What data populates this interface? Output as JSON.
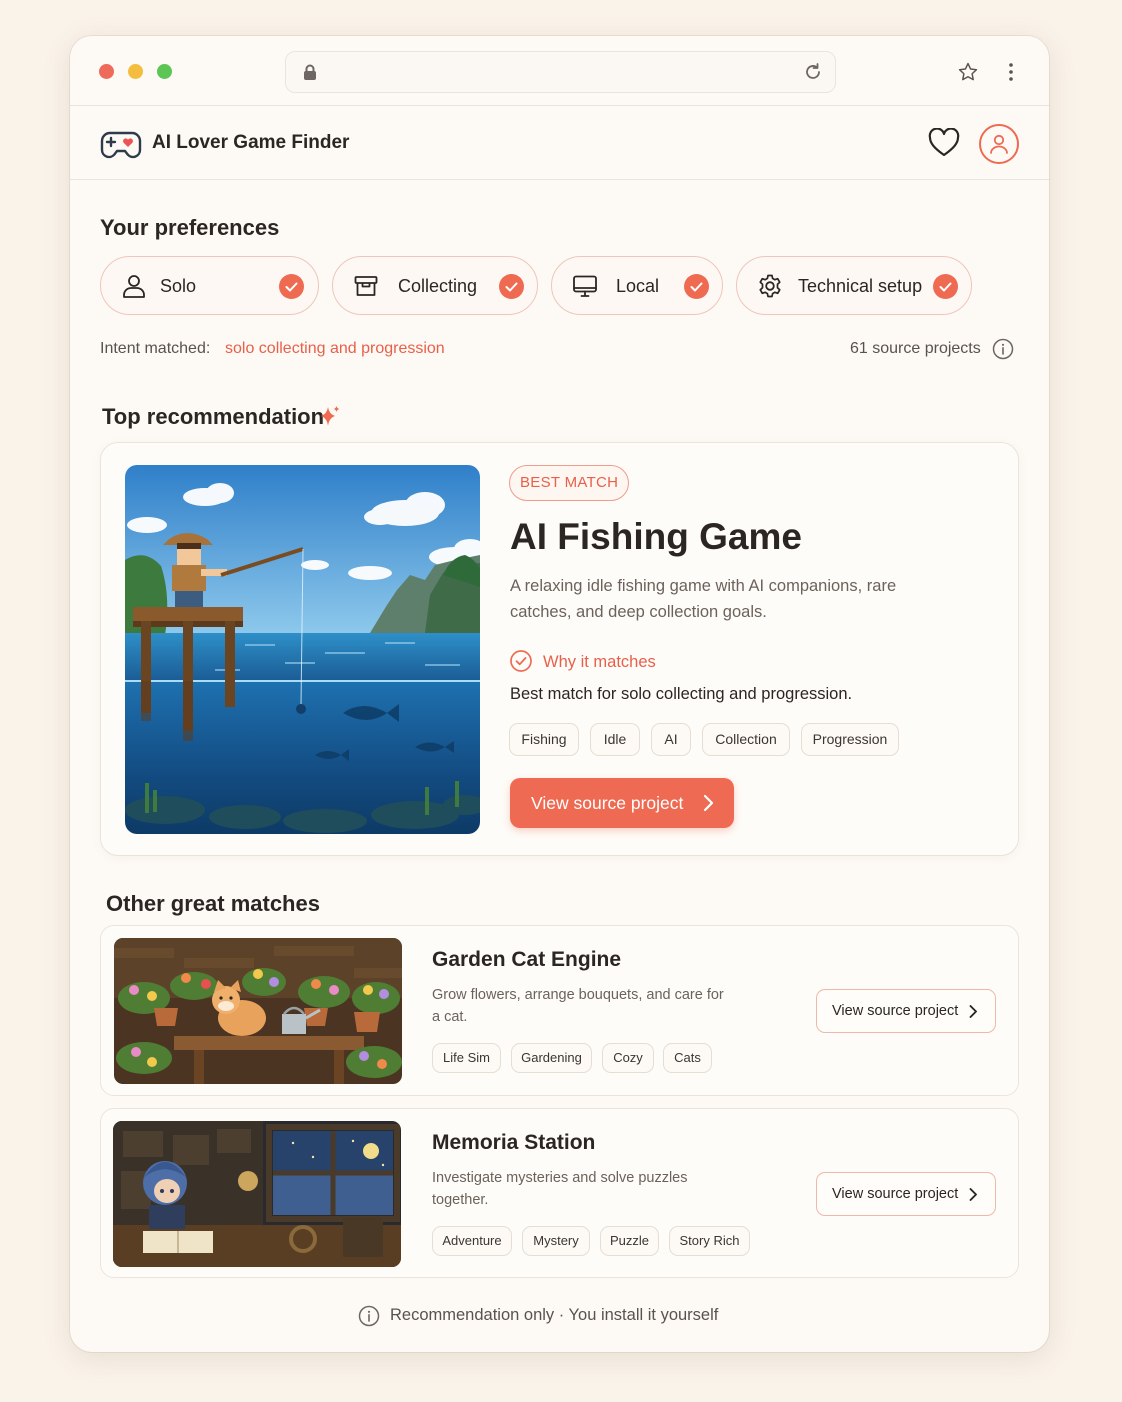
{
  "app": {
    "title": "AI Lover Game Finder"
  },
  "preferences": {
    "heading": "Your preferences",
    "chips": [
      {
        "label": "Solo",
        "icon": "person-icon"
      },
      {
        "label": "Collecting",
        "icon": "archive-box-icon"
      },
      {
        "label": "Local",
        "icon": "monitor-icon"
      },
      {
        "label": "Technical setup",
        "icon": "gear-icon"
      }
    ],
    "intent_label": "Intent matched:",
    "intent_value": "solo collecting and progression",
    "source_count": "61 source projects"
  },
  "top": {
    "heading": "Top recommendation",
    "badge": "BEST MATCH",
    "title": "AI Fishing Game",
    "description": "A relaxing idle fishing game with AI companions, rare catches, and deep collection goals.",
    "why_label": "Why it matches",
    "why_text": "Best match for solo collecting and progression.",
    "tags": [
      "Fishing",
      "Idle",
      "AI",
      "Collection",
      "Progression"
    ],
    "button": "View source project"
  },
  "others": {
    "heading": "Other great matches",
    "items": [
      {
        "title": "Garden Cat Engine",
        "description": "Grow flowers, arrange bouquets, and care for a cat.",
        "tags": [
          "Life Sim",
          "Gardening",
          "Cozy",
          "Cats"
        ],
        "button": "View source project"
      },
      {
        "title": "Memoria Station",
        "description": "Investigate mysteries and solve puzzles together.",
        "tags": [
          "Adventure",
          "Mystery",
          "Puzzle",
          "Story Rich"
        ],
        "button": "View source project"
      }
    ]
  },
  "footer": {
    "text": "Recommendation only · You install it yourself"
  },
  "colors": {
    "accent": "#ee6b52",
    "background": "#faf3ea",
    "card": "#fdfaf5"
  }
}
